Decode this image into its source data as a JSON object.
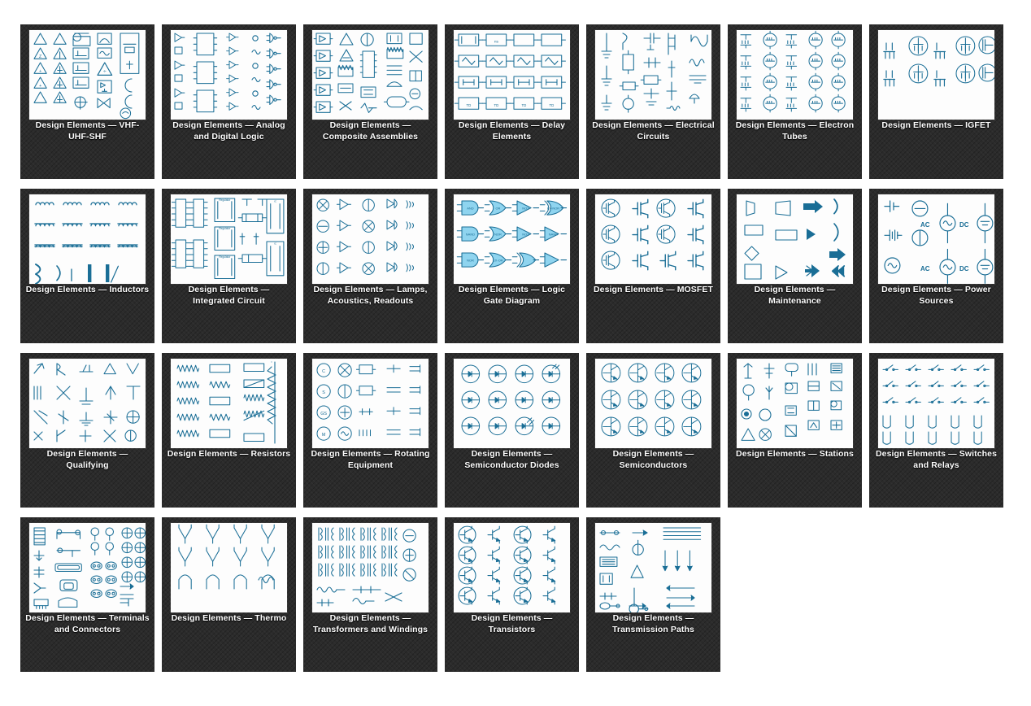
{
  "page": {
    "background_color": "#ffffff",
    "card_background_color": "#2b2b2b",
    "label_color": "#ffffff",
    "symbol_color": "#1a6e96",
    "symbol_fill_color": "#8fd4ef",
    "thumbnail_background": "#fdfdfd",
    "columns": 7,
    "total_cards": 26
  },
  "cards": [
    {
      "id": "vhf-uhf-shf",
      "label": "Design Elements — VHF-UHF-SHF",
      "thumb": "vhf",
      "row": 1,
      "col": 1
    },
    {
      "id": "analog-and-digital-logic",
      "label": "Design Elements — Analog and Digital Logic",
      "thumb": "analog",
      "row": 1,
      "col": 2
    },
    {
      "id": "composite-assemblies",
      "label": "Design Elements — Composite Assemblies",
      "thumb": "composite",
      "row": 1,
      "col": 3
    },
    {
      "id": "delay-elements",
      "label": "Design Elements — Delay Elements",
      "thumb": "delay",
      "row": 1,
      "col": 4
    },
    {
      "id": "electrical-circuits",
      "label": "Design Elements — Electrical Circuits",
      "thumb": "electrical",
      "row": 1,
      "col": 5
    },
    {
      "id": "electron-tubes",
      "label": "Design Elements — Electron Tubes",
      "thumb": "tubes",
      "row": 1,
      "col": 6
    },
    {
      "id": "igfet",
      "label": "Design Elements — IGFET",
      "thumb": "igfet",
      "row": 1,
      "col": 7
    },
    {
      "id": "inductors",
      "label": "Design Elements — Inductors",
      "thumb": "inductors",
      "row": 2,
      "col": 1
    },
    {
      "id": "integrated-circuit",
      "label": "Design Elements — Integrated Circuit",
      "thumb": "ic",
      "row": 2,
      "col": 2
    },
    {
      "id": "lamps-acoustics-readouts",
      "label": "Design Elements — Lamps, Acoustics, Readouts",
      "thumb": "lamps",
      "row": 2,
      "col": 3
    },
    {
      "id": "logic-gate-diagram",
      "label": "Design Elements — Logic Gate Diagram",
      "thumb": "logic",
      "row": 2,
      "col": 4
    },
    {
      "id": "mosfet",
      "label": "Design Elements — MOSFET",
      "thumb": "mosfet",
      "row": 2,
      "col": 5
    },
    {
      "id": "maintenance",
      "label": "Design Elements — Maintenance",
      "thumb": "maintenance",
      "row": 2,
      "col": 6
    },
    {
      "id": "power-sources",
      "label": "Design Elements — Power Sources",
      "thumb": "power",
      "row": 2,
      "col": 7
    },
    {
      "id": "qualifying",
      "label": "Design Elements — Qualifying",
      "thumb": "qualifying",
      "row": 3,
      "col": 1
    },
    {
      "id": "resistors",
      "label": "Design Elements — Resistors",
      "thumb": "resistors",
      "row": 3,
      "col": 2
    },
    {
      "id": "rotating-equipment",
      "label": "Design Elements — Rotating Equipment",
      "thumb": "rotating",
      "row": 3,
      "col": 3
    },
    {
      "id": "semiconductor-diodes",
      "label": "Design Elements — Semiconductor Diodes",
      "thumb": "diodes",
      "row": 3,
      "col": 4
    },
    {
      "id": "semiconductors",
      "label": "Design Elements — Semiconductors",
      "thumb": "semis",
      "row": 3,
      "col": 5
    },
    {
      "id": "stations",
      "label": "Design Elements — Stations",
      "thumb": "stations",
      "row": 3,
      "col": 6
    },
    {
      "id": "switches-and-relays",
      "label": "Design Elements — Switches and Relays",
      "thumb": "switches",
      "row": 3,
      "col": 7
    },
    {
      "id": "terminals-and-connectors",
      "label": "Design Elements — Terminals and Connectors",
      "thumb": "terminals",
      "row": 4,
      "col": 1
    },
    {
      "id": "thermo",
      "label": "Design Elements — Thermo",
      "thumb": "thermo",
      "row": 4,
      "col": 2
    },
    {
      "id": "transformers-and-windings",
      "label": "Design Elements — Transformers and Windings",
      "thumb": "transformers",
      "row": 4,
      "col": 3
    },
    {
      "id": "transistors",
      "label": "Design Elements — Transistors",
      "thumb": "transistors",
      "row": 4,
      "col": 4
    },
    {
      "id": "transmission-paths",
      "label": "Design Elements — Transmission Paths",
      "thumb": "transmission",
      "row": 4,
      "col": 5
    }
  ],
  "logic_gate_labels": [
    "AND",
    "OR",
    "NOT",
    "EX-NOR",
    "NAND",
    "NOR",
    "NOT",
    "NAND",
    "NOR",
    "EX-OR"
  ],
  "power_source_labels": [
    "AC",
    "DC",
    "AC",
    "DC"
  ],
  "rotating_equipment_labels": [
    "C",
    "S",
    "GS",
    "M"
  ]
}
